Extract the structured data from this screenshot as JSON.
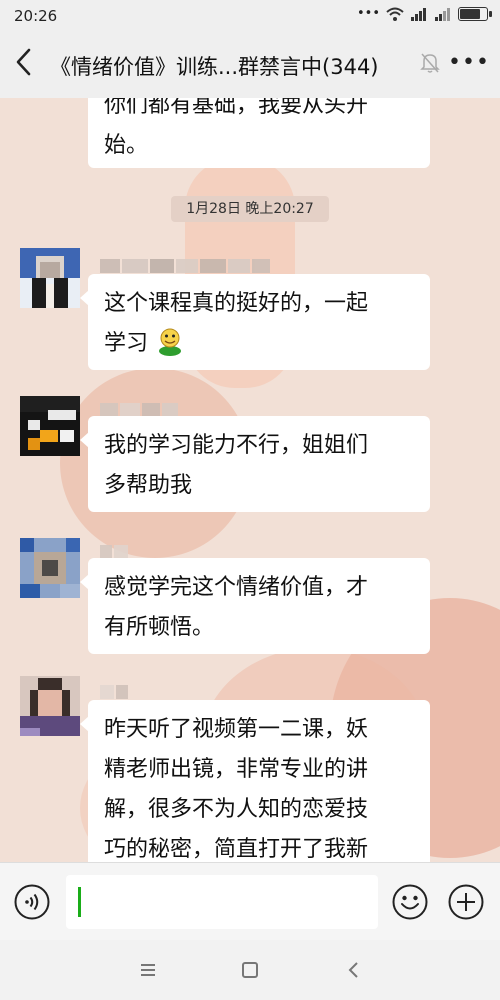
{
  "status_bar": {
    "time": "20:26",
    "battery_level": 0.85
  },
  "header": {
    "back_glyph": "‹",
    "title": "《情绪价值》训练...群禁言中(344)",
    "more_glyph": "•••"
  },
  "chat": {
    "top_message_partial": {
      "line1": "你们都有基础，我要从头开",
      "line2": "始。"
    },
    "timestamp": "1月28日 晚上20:27",
    "messages": [
      {
        "line1": "这个课程真的挺好的，一起",
        "line2": "学习"
      },
      {
        "line1": "我的学习能力不行，姐姐们",
        "line2": "多帮助我"
      },
      {
        "line1": "感觉学完这个情绪价值，才",
        "line2": "有所顿悟。"
      },
      {
        "line1": "昨天听了视频第一二课，妖",
        "line2": "精老师出镜，非常专业的讲",
        "line3": "解，很多不为人知的恋爱技",
        "line4": "巧的秘密，简直打开了我新"
      }
    ]
  },
  "input": {
    "value": ""
  },
  "icons": {
    "voice": "voice-icon",
    "emoji": "emoji-icon",
    "plus": "plus-icon",
    "mute": "bell-muted-icon",
    "back": "back-arrow-icon"
  },
  "colors": {
    "accent": "#1aad19",
    "bubble": "#ffffff",
    "chat_background": "#f2e0d6"
  }
}
